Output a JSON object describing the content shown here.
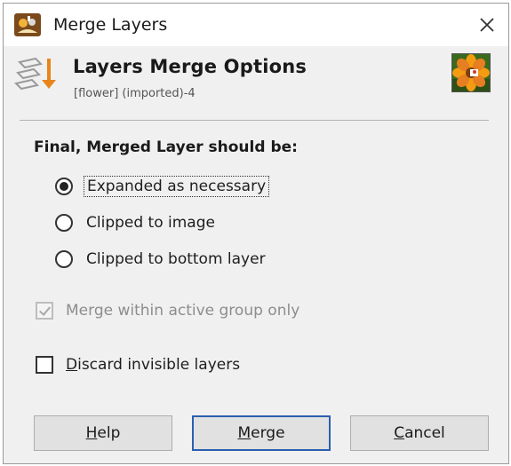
{
  "window": {
    "title": "Merge Layers",
    "close_label": "×"
  },
  "header": {
    "title": "Layers Merge Options",
    "subtitle": "[flower] (imported)-4"
  },
  "options": {
    "section_label": "Final, Merged Layer should be:",
    "radios": [
      {
        "label": "Expanded as necessary",
        "checked": true
      },
      {
        "label": "Clipped to image",
        "checked": false
      },
      {
        "label": "Clipped to bottom layer",
        "checked": false
      }
    ],
    "merge_active_group": {
      "label": "Merge within active group only",
      "checked": true,
      "disabled": true
    },
    "discard_invisible": {
      "label_underlined": "D",
      "label_rest": "iscard invisible layers",
      "checked": false
    }
  },
  "buttons": {
    "help": {
      "underlined": "H",
      "rest": "elp"
    },
    "merge": {
      "underlined": "M",
      "rest": "erge"
    },
    "cancel": {
      "underlined": "C",
      "rest": "ancel"
    }
  },
  "colors": {
    "default_button_border": "#2a5fb0",
    "dialog_background": "#f0f0f0",
    "merge_arrow": "#e8851a"
  }
}
